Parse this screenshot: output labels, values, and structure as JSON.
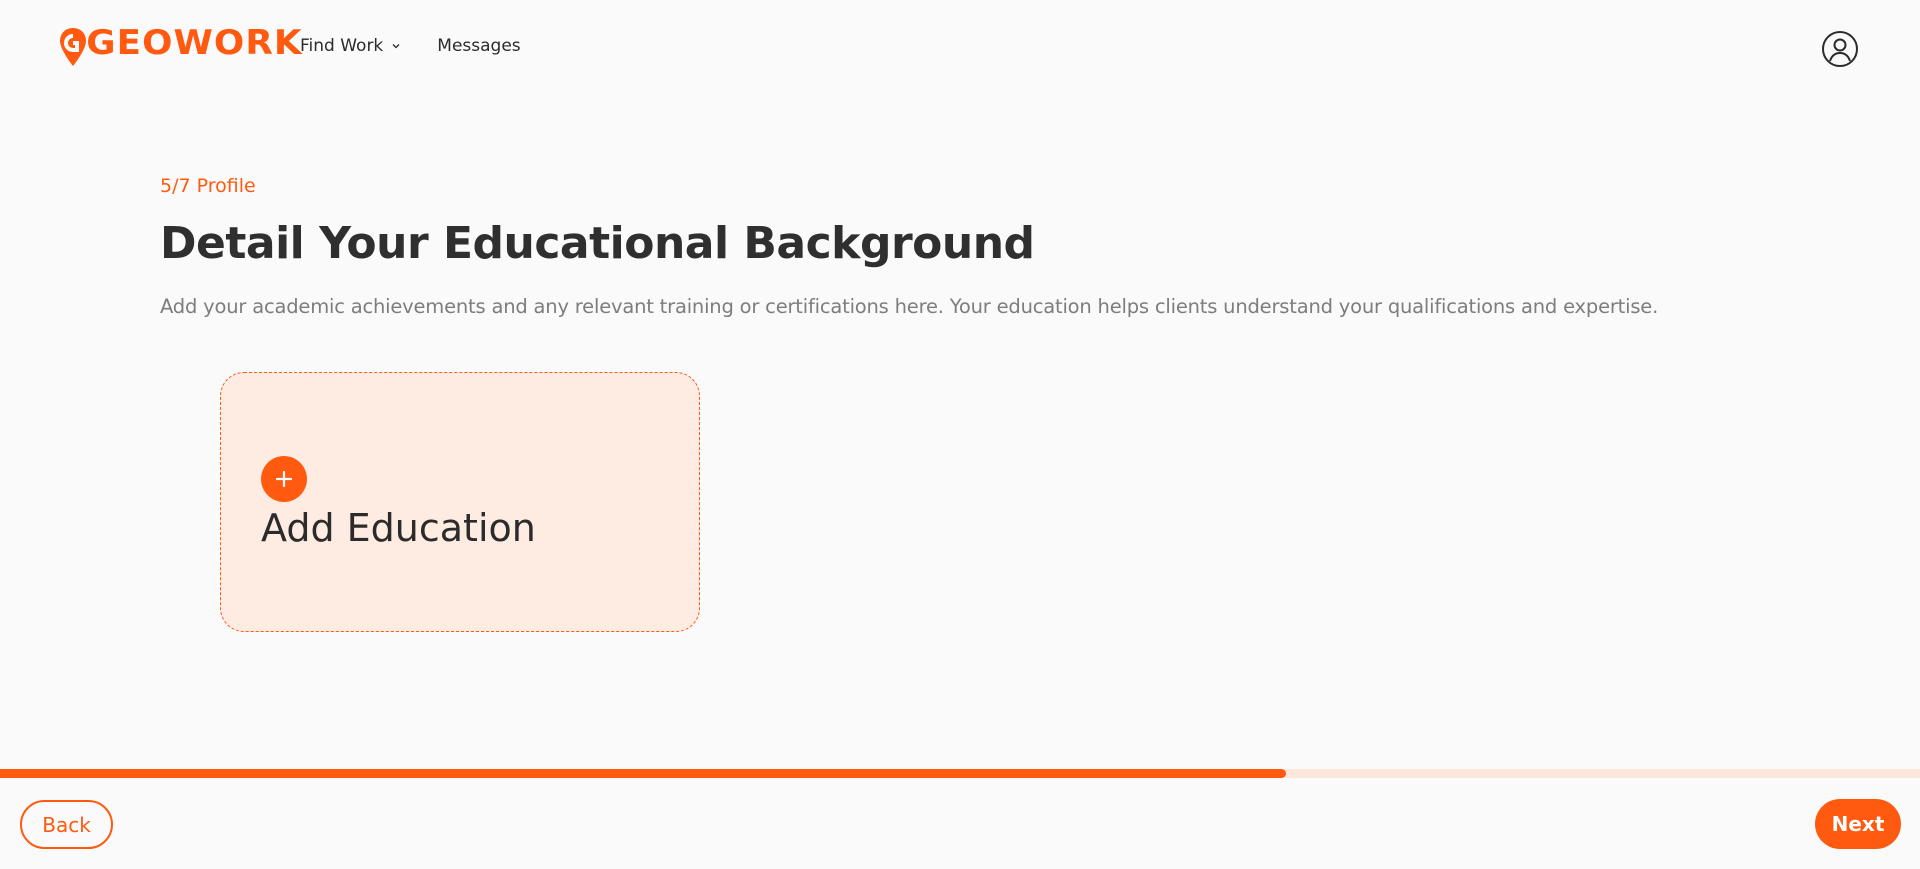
{
  "brand": {
    "logo_text": "GEOWORK",
    "accent_color": "#ff5a10"
  },
  "nav": {
    "find_work": "Find Work",
    "find_work_icon": "chevron-down-icon",
    "messages": "Messages"
  },
  "user": {
    "icon": "user-circle-icon"
  },
  "step": {
    "label": "5/7 Profile"
  },
  "main": {
    "title": "Detail Your Educational Background",
    "subtitle": "Add your academic achievements and any relevant training or certifications here. Your education helps clients understand your qualifications and expertise."
  },
  "education_card": {
    "icon": "plus-icon",
    "label": "Add Education"
  },
  "progress": {
    "percent": 67
  },
  "footer": {
    "back": "Back",
    "next": "Next"
  }
}
